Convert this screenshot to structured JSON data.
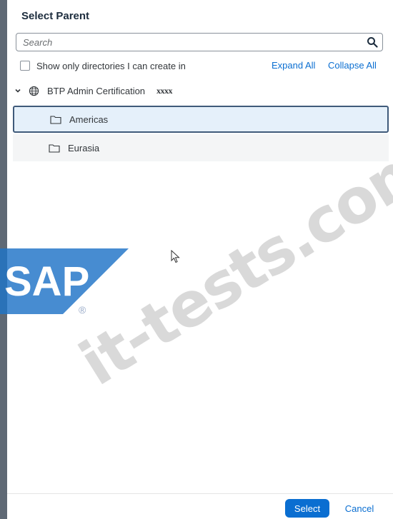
{
  "dialog": {
    "title": "Select Parent",
    "search": {
      "placeholder": "Search"
    },
    "filter": {
      "label": "Show only directories I can create in",
      "checked": false
    },
    "actions": {
      "expand_all": "Expand All",
      "collapse_all": "Collapse All"
    }
  },
  "tree": {
    "root": {
      "label": "BTP Admin Certification",
      "suffix": "xxxx",
      "icon": "globe-icon",
      "expanded": true
    },
    "children": [
      {
        "label": "Americas",
        "icon": "folder-icon",
        "selected": true
      },
      {
        "label": "Eurasia",
        "icon": "folder-icon",
        "selected": false
      }
    ]
  },
  "footer": {
    "select_label": "Select",
    "cancel_label": "Cancel"
  },
  "watermark": {
    "logo_text": "SAP",
    "registered": "®",
    "text": "it-tests.com"
  },
  "colors": {
    "accent": "#0a6ed1",
    "selection_bg": "#e5f0fa",
    "selection_border": "#3f5a7a"
  }
}
